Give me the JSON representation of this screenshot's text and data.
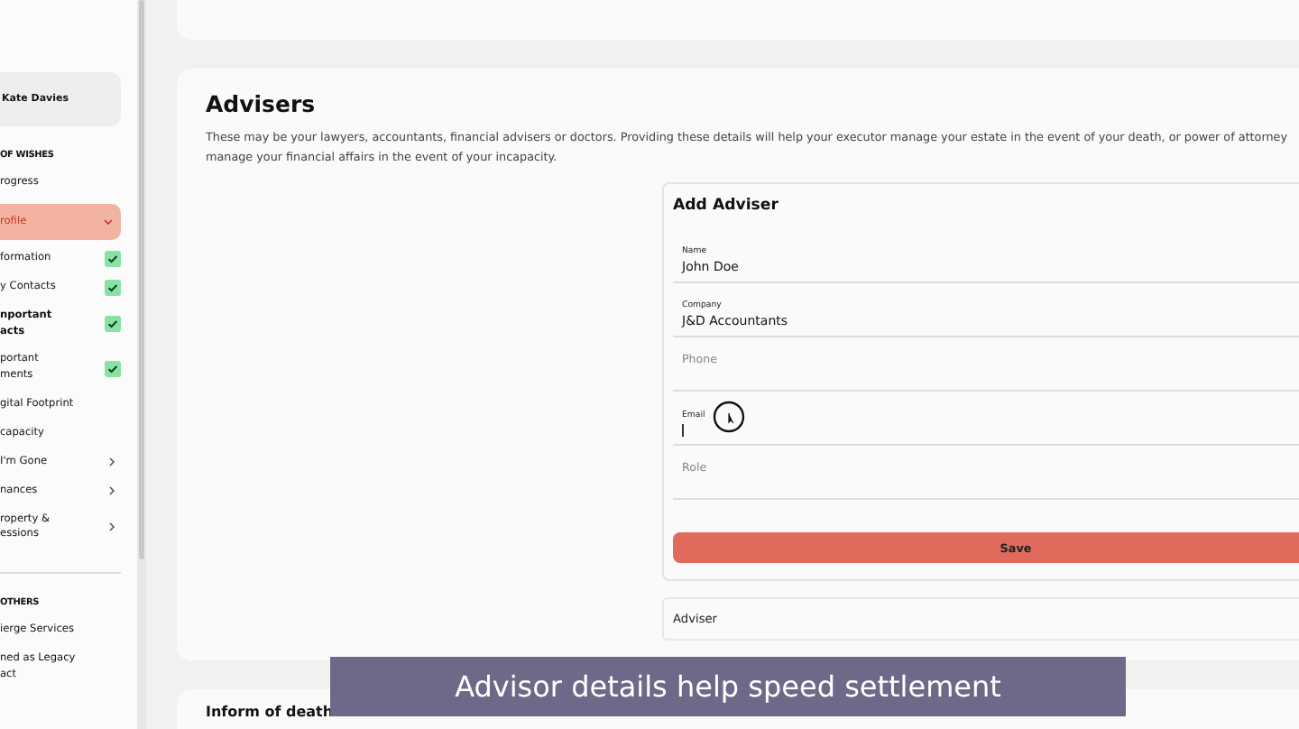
{
  "sidebar": {
    "user": "Kate Davies",
    "section": "OF WISHES",
    "items": [
      {
        "label": "rogress",
        "kind": "link"
      },
      {
        "label": "rofile",
        "kind": "group",
        "selected": true,
        "expanded": true
      },
      {
        "label": "formation",
        "kind": "sub",
        "checked": true,
        "selected": false
      },
      {
        "label": "y Contacts",
        "kind": "sub",
        "checked": true,
        "selected": false
      },
      {
        "label": "nportant\nacts",
        "kind": "sub",
        "checked": true,
        "selected": true
      },
      {
        "label": "portant\nments",
        "kind": "sub",
        "checked": true,
        "selected": false
      },
      {
        "label": "gital Footprint",
        "kind": "sub",
        "checked": false,
        "selected": false
      },
      {
        "label": "capacity",
        "kind": "sub",
        "checked": false,
        "selected": false
      },
      {
        "label": "I'm Gone",
        "kind": "nav"
      },
      {
        "label": "nances",
        "kind": "nav"
      },
      {
        "label": "roperty &\nessions",
        "kind": "nav"
      }
    ],
    "others_heading": "OTHERS",
    "others": [
      {
        "label": "ierge Services"
      },
      {
        "label": "ned as Legacy\nact"
      }
    ]
  },
  "advisers": {
    "title": "Advisers",
    "description": "These may be your lawyers, accountants, financial advisers or doctors. Providing these details will help your executor manage your estate in the event of your death, or power of attorney manage your financial affairs in the event of your incapacity.",
    "form": {
      "title": "Add Adviser",
      "fields": [
        {
          "kind": "filled",
          "label": "Name",
          "value": "John Doe"
        },
        {
          "kind": "filled",
          "label": "Company",
          "value": "J&D Accountants"
        },
        {
          "kind": "empty",
          "placeholder": "Phone"
        },
        {
          "kind": "focused",
          "label": "Email"
        },
        {
          "kind": "empty",
          "placeholder": "Role"
        }
      ],
      "button": "Save"
    },
    "collapsed": "Adviser"
  },
  "next_section": {
    "title": "Inform of death"
  },
  "caption": "Advisor details help speed settlement"
}
